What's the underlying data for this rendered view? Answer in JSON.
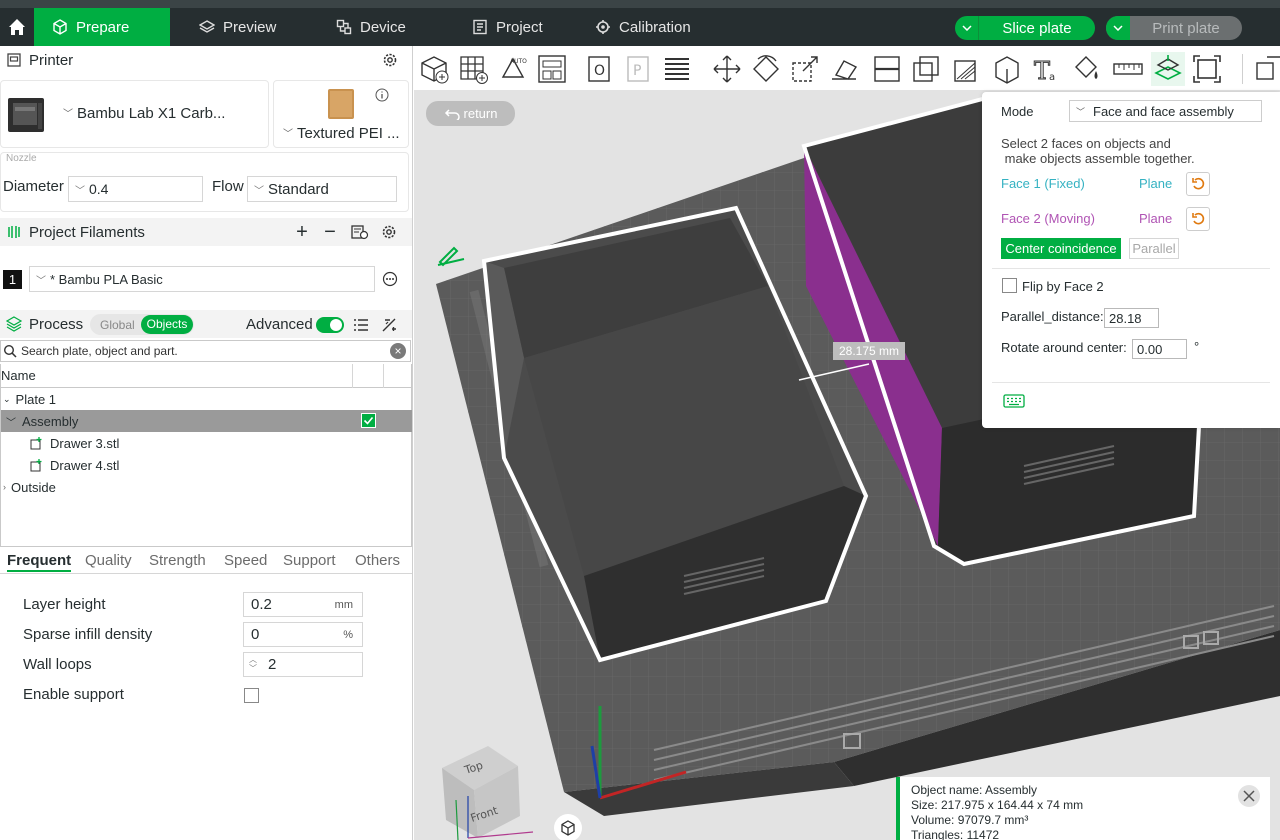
{
  "topbar": {
    "tabs": [
      {
        "label": "Prepare",
        "icon": "cube-icon",
        "active": true
      },
      {
        "label": "Preview",
        "icon": "layers-icon"
      },
      {
        "label": "Device",
        "icon": "device-icon"
      },
      {
        "label": "Project",
        "icon": "document-icon"
      },
      {
        "label": "Calibration",
        "icon": "calibration-icon"
      }
    ],
    "slice_label": "Slice plate",
    "print_label": "Print plate",
    "accent": "#00ae42"
  },
  "printer": {
    "section_title": "Printer",
    "name": "Bambu Lab X1 Carb...",
    "plate": "Textured PEI ...",
    "nozzle_label": "Nozzle",
    "diameter_label": "Diameter",
    "diameter_value": "0.4",
    "flow_label": "Flow",
    "flow_value": "Standard"
  },
  "filaments": {
    "section_title": "Project Filaments",
    "items": [
      {
        "index": "1",
        "name": "* Bambu PLA Basic"
      }
    ]
  },
  "process": {
    "section_title": "Process",
    "toggle_global": "Global",
    "toggle_objects": "Objects",
    "advanced_label": "Advanced",
    "search_placeholder": "Search plate, object and part.",
    "tree_header": "Name",
    "tree": {
      "plate": "Plate 1",
      "assembly": "Assembly",
      "children": [
        "Drawer 3.stl",
        "Drawer 4.stl"
      ],
      "outside": "Outside"
    },
    "subtabs": [
      "Frequent",
      "Quality",
      "Strength",
      "Speed",
      "Support",
      "Others"
    ],
    "params": {
      "layer_height_label": "Layer height",
      "layer_height_value": "0.2",
      "layer_height_unit": "mm",
      "infill_label": "Sparse infill density",
      "infill_value": "0",
      "infill_unit": "%",
      "wall_loops_label": "Wall loops",
      "wall_loops_value": "2",
      "support_label": "Enable support"
    }
  },
  "viewport": {
    "return_label": "return",
    "measure_label": "28.175 mm",
    "cube_top": "Top",
    "cube_front": "Front"
  },
  "assembly_panel": {
    "mode_label": "Mode",
    "mode_value": "Face and face assembly",
    "instruction_line1": "Select 2 faces on objects and",
    "instruction_line2": " make objects assemble together.",
    "face1_label": "Face 1 (Fixed)",
    "face1_type": "Plane",
    "face2_label": "Face 2 (Moving)",
    "face2_type": "Plane",
    "center_label": "Center coincidence",
    "parallel_label": "Parallel",
    "flip_label": "Flip by Face 2",
    "parallel_distance_label": "Parallel_distance:",
    "parallel_distance_value": "28.18",
    "rotate_label": "Rotate around center:",
    "rotate_value": "0.00",
    "rotate_unit": "°",
    "face1_color": "#35b2c2",
    "face2_color": "#b054b4"
  },
  "object_info": {
    "name_line": "Object name: Assembly",
    "size_line": "Size: 217.975 x 164.44 x 74 mm",
    "volume_line": "Volume: 97079.7 mm³",
    "triangles_line": "Triangles: 11472"
  }
}
